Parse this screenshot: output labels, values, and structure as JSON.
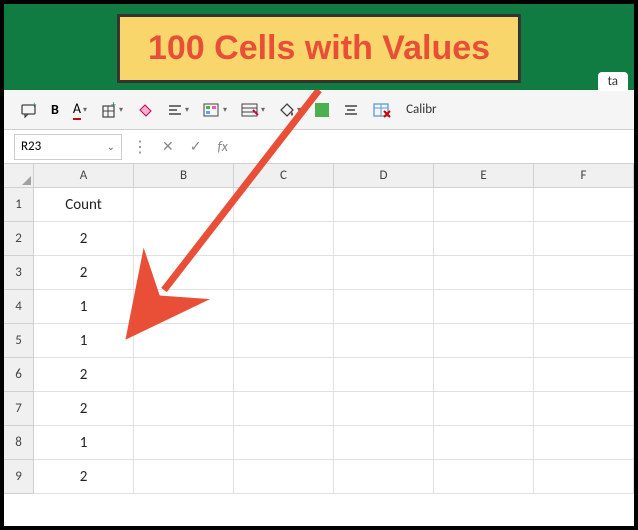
{
  "callout": {
    "text": "100 Cells with Values"
  },
  "tab_hint": "ta",
  "toolbar": {
    "font_name": "Calibr"
  },
  "namebox": {
    "value": "R23"
  },
  "formula_bar": {
    "value": ""
  },
  "columns": [
    "A",
    "B",
    "C",
    "D",
    "E",
    "F"
  ],
  "rows": [
    {
      "num": "1",
      "a": "Count"
    },
    {
      "num": "2",
      "a": "2"
    },
    {
      "num": "3",
      "a": "2"
    },
    {
      "num": "4",
      "a": "1"
    },
    {
      "num": "5",
      "a": "1"
    },
    {
      "num": "6",
      "a": "2"
    },
    {
      "num": "7",
      "a": "2"
    },
    {
      "num": "8",
      "a": "1"
    },
    {
      "num": "9",
      "a": "2"
    }
  ]
}
